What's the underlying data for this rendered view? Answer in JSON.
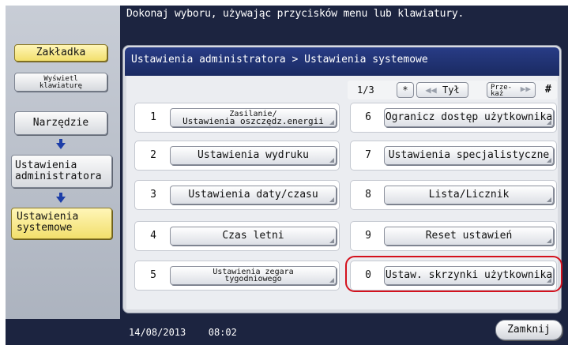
{
  "header": {
    "message": "Dokonaj wyboru, używając przycisków menu lub klawiatury."
  },
  "sidebar": {
    "tab_label": "Zakładka",
    "keyboard_label_line1": "Wyświetl",
    "keyboard_label_line2": "klawiaturę",
    "tool_label": "Narzędzie",
    "admin_line1": "Ustawienia",
    "admin_line2": "administratora",
    "system_line1": "Ustawienia",
    "system_line2": "systemowe"
  },
  "main": {
    "breadcrumb": "Ustawienia administratora > Ustawienia systemowe",
    "pager": {
      "page": "1/3",
      "star": "*",
      "prev_label": "Tył",
      "next_line1": "Prze-",
      "next_line2": "każ",
      "hash": "#"
    },
    "items": [
      {
        "num": "1",
        "line1": "Zasilanie/",
        "line2": "Ustawienia oszczędz.energii"
      },
      {
        "num": "2",
        "label": "Ustawienia wydruku"
      },
      {
        "num": "3",
        "label": "Ustawienia daty/czasu"
      },
      {
        "num": "4",
        "label": "Czas letni"
      },
      {
        "num": "5",
        "line1": "Ustawienia zegara",
        "line2": "tygodniowego"
      },
      {
        "num": "6",
        "label": "Ogranicz dostęp użytkownika"
      },
      {
        "num": "7",
        "label": "Ustawienia specjalistyczne"
      },
      {
        "num": "8",
        "label": "Lista/Licznik"
      },
      {
        "num": "9",
        "label": "Reset ustawień"
      },
      {
        "num": "0",
        "label": "Ustaw. skrzynki użytkownika"
      }
    ]
  },
  "footer": {
    "date": "14/08/2013",
    "time": "08:02",
    "close_label": "Zamknij"
  },
  "colors": {
    "frame": "#1c2440",
    "header_bar": "#283c86",
    "highlight": "#d4111d",
    "active_tab": "#f2df6c"
  }
}
